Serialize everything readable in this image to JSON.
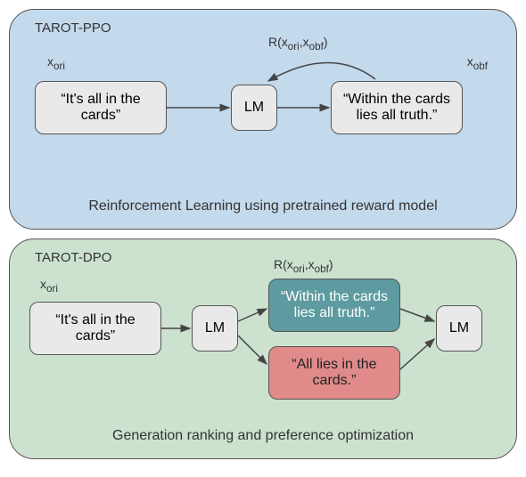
{
  "ppo": {
    "title": "TAROT-PPO",
    "x_ori_label": "x",
    "x_ori_sub": "ori",
    "x_obf_label": "x",
    "x_obf_sub": "obf",
    "reward_label": "R(x",
    "reward_sub1": "ori",
    "reward_mid": ",x",
    "reward_sub2": "obf",
    "reward_close": ")",
    "input_text": "“It's all in the cards”",
    "lm_label": "LM",
    "output_text": "“Within the cards lies all truth.”",
    "caption": "Reinforcement Learning using pretrained reward model"
  },
  "dpo": {
    "title": "TAROT-DPO",
    "x_ori_label": "x",
    "x_ori_sub": "ori",
    "reward_label": "R(x",
    "reward_sub1": "ori",
    "reward_mid": ",x",
    "reward_sub2": "obf",
    "reward_close": ")",
    "input_text": "“It's all in the cards”",
    "lm_label_1": "LM",
    "lm_label_2": "LM",
    "candidate_good": "“Within the cards lies all truth.”",
    "candidate_bad": "“All lies in the cards.”",
    "caption": "Generation ranking and preference optimization"
  }
}
